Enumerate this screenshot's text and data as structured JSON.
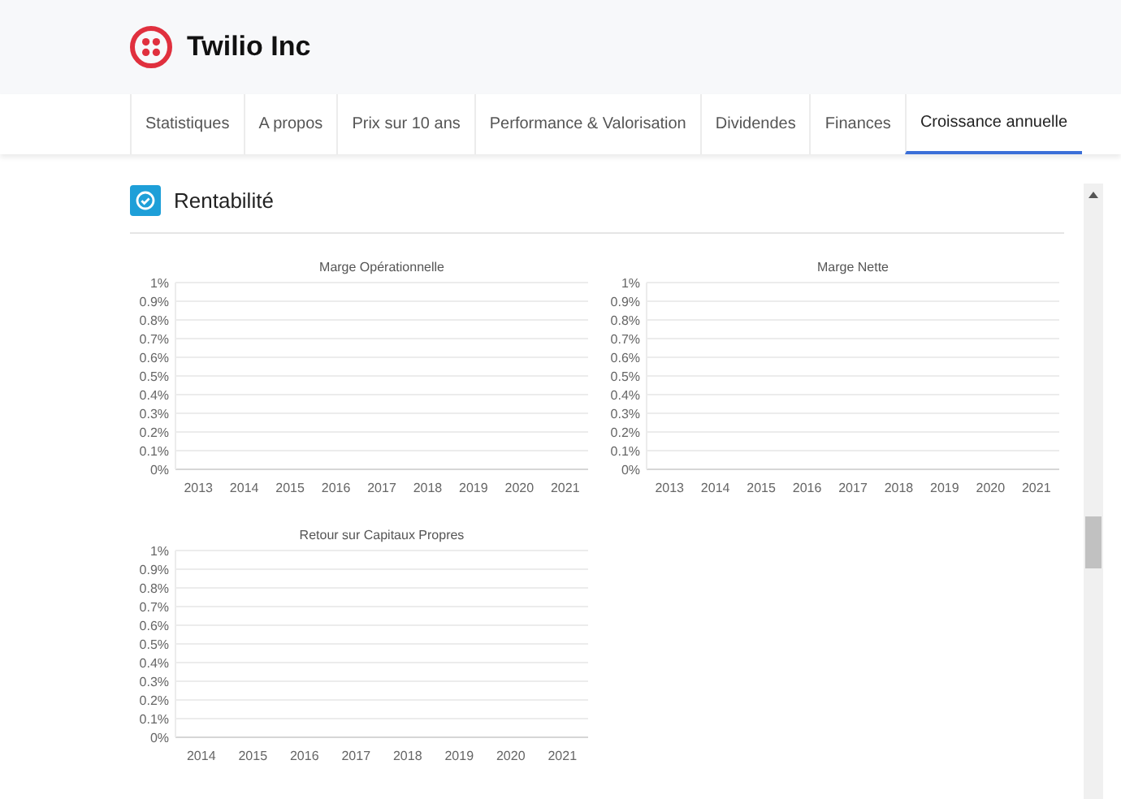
{
  "header": {
    "title": "Twilio Inc"
  },
  "tabs": [
    {
      "label": "Statistiques",
      "selected": false
    },
    {
      "label": "A propos",
      "selected": false
    },
    {
      "label": "Prix sur 10 ans",
      "selected": false
    },
    {
      "label": "Performance & Valorisation",
      "selected": false
    },
    {
      "label": "Dividendes",
      "selected": false
    },
    {
      "label": "Finances",
      "selected": false
    },
    {
      "label": "Croissance annuelle",
      "selected": true
    }
  ],
  "section": {
    "title": "Rentabilité"
  },
  "charts": [
    {
      "chart_data": {
        "type": "line",
        "grid": true,
        "title": "Marge Opérationnelle",
        "categories": [
          "2013",
          "2014",
          "2015",
          "2016",
          "2017",
          "2018",
          "2019",
          "2020",
          "2021"
        ],
        "ylim": [
          0,
          1
        ],
        "yticks": [
          {
            "value": 0,
            "label": "0%"
          },
          {
            "value": 0.1,
            "label": "0.1%"
          },
          {
            "value": 0.2,
            "label": "0.2%"
          },
          {
            "value": 0.3,
            "label": "0.3%"
          },
          {
            "value": 0.4,
            "label": "0.4%"
          },
          {
            "value": 0.5,
            "label": "0.5%"
          },
          {
            "value": 0.6,
            "label": "0.6%"
          },
          {
            "value": 0.7,
            "label": "0.7%"
          },
          {
            "value": 0.8,
            "label": "0.8%"
          },
          {
            "value": 0.9,
            "label": "0.9%"
          },
          {
            "value": 1,
            "label": "1%"
          }
        ]
      }
    },
    {
      "chart_data": {
        "type": "line",
        "grid": true,
        "title": "Marge Nette",
        "categories": [
          "2013",
          "2014",
          "2015",
          "2016",
          "2017",
          "2018",
          "2019",
          "2020",
          "2021"
        ],
        "ylim": [
          0,
          1
        ],
        "yticks": [
          {
            "value": 0,
            "label": "0%"
          },
          {
            "value": 0.1,
            "label": "0.1%"
          },
          {
            "value": 0.2,
            "label": "0.2%"
          },
          {
            "value": 0.3,
            "label": "0.3%"
          },
          {
            "value": 0.4,
            "label": "0.4%"
          },
          {
            "value": 0.5,
            "label": "0.5%"
          },
          {
            "value": 0.6,
            "label": "0.6%"
          },
          {
            "value": 0.7,
            "label": "0.7%"
          },
          {
            "value": 0.8,
            "label": "0.8%"
          },
          {
            "value": 0.9,
            "label": "0.9%"
          },
          {
            "value": 1,
            "label": "1%"
          }
        ]
      }
    },
    {
      "chart_data": {
        "type": "line",
        "grid": true,
        "title": "Retour sur Capitaux Propres",
        "categories": [
          "2014",
          "2015",
          "2016",
          "2017",
          "2018",
          "2019",
          "2020",
          "2021"
        ],
        "ylim": [
          0,
          1
        ],
        "yticks": [
          {
            "value": 0,
            "label": "0%"
          },
          {
            "value": 0.1,
            "label": "0.1%"
          },
          {
            "value": 0.2,
            "label": "0.2%"
          },
          {
            "value": 0.3,
            "label": "0.3%"
          },
          {
            "value": 0.4,
            "label": "0.4%"
          },
          {
            "value": 0.5,
            "label": "0.5%"
          },
          {
            "value": 0.6,
            "label": "0.6%"
          },
          {
            "value": 0.7,
            "label": "0.7%"
          },
          {
            "value": 0.8,
            "label": "0.8%"
          },
          {
            "value": 0.9,
            "label": "0.9%"
          },
          {
            "value": 1,
            "label": "1%"
          }
        ]
      }
    }
  ]
}
